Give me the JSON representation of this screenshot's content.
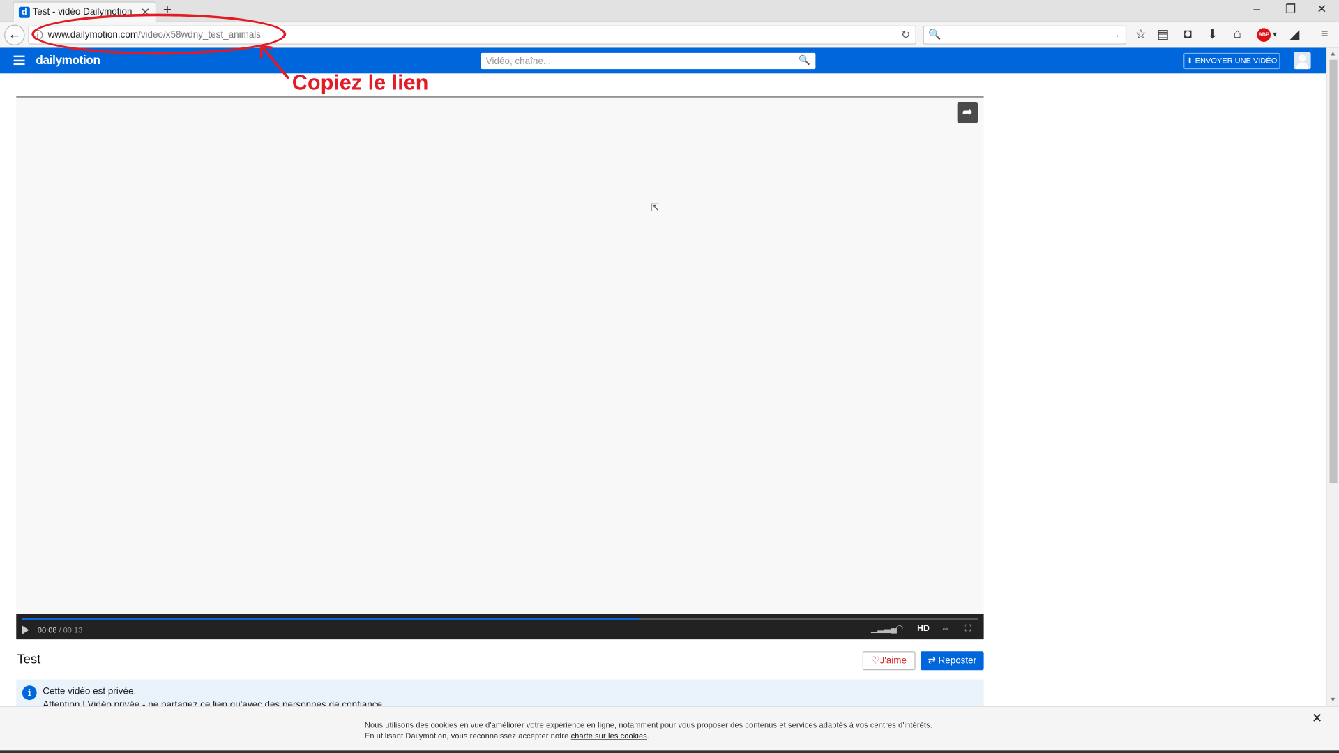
{
  "browser": {
    "tab_title": "Test - vidéo Dailymotion",
    "tab_favicon": "d",
    "url_host": "www.dailymotion.com",
    "url_path": "/video/x58wdny_test_animals",
    "search_placeholder": ""
  },
  "site": {
    "logo": "dailymotion",
    "search_placeholder": "Vidéo, chaîne...",
    "upload_label": "⬆ ENVOYER UNE VIDÉO",
    "brand_color": "#0066dc"
  },
  "annotation": {
    "text": "Copiez le lien",
    "color": "#e21b24"
  },
  "player": {
    "current_time": "00:08",
    "separator": " / ",
    "duration": "00:13",
    "progress": 0.645,
    "quality": "HD"
  },
  "video": {
    "title": "Test",
    "like_label": "J'aime",
    "repost_label": "Reposter"
  },
  "private_notice": {
    "line1": "Cette vidéo est privée.",
    "line2": "Attention ! Vidéo privée - ne partagez ce lien qu'avec des personnes de confiance."
  },
  "cookie_banner": {
    "line1": "Nous utilisons des cookies en vue d'améliorer votre expérience en ligne, notamment pour vous proposer des contenus et services adaptés à vos centres d'intérêts.",
    "line2_prefix": "En utilisant Dailymotion, vous reconnaissez accepter notre ",
    "line2_link": "charte sur les cookies",
    "line2_suffix": "."
  }
}
